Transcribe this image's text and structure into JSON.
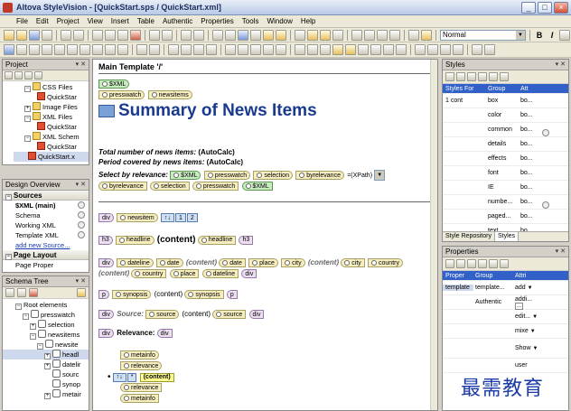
{
  "window": {
    "title": "Altova StyleVision - [QuickStart.sps / QuickStart.xml]"
  },
  "menu": [
    "File",
    "Edit",
    "Project",
    "View",
    "Insert",
    "Table",
    "Authentic",
    "Properties",
    "Tools",
    "Window",
    "Help"
  ],
  "toolbar": {
    "style_combo": "Normal",
    "bold": "B",
    "italic": "I"
  },
  "project": {
    "title": "Project",
    "items": [
      {
        "label": "CSS Files",
        "kind": "folder"
      },
      {
        "label": "QuickStar",
        "kind": "file"
      },
      {
        "label": "Image Files",
        "kind": "folder"
      },
      {
        "label": "XML Files",
        "kind": "folder"
      },
      {
        "label": "QuickStar",
        "kind": "file"
      },
      {
        "label": "XML Schem",
        "kind": "folder"
      },
      {
        "label": "QuickStar",
        "kind": "file"
      },
      {
        "label": "QuickStart.x",
        "kind": "file"
      }
    ]
  },
  "design_overview": {
    "title": "Design Overview",
    "sources_label": "Sources",
    "rows": [
      "$XML (main)",
      "Schema",
      "Working XML",
      "Template XML"
    ],
    "add_link": "add new Source...",
    "page_layout_label": "Page Layout",
    "page_properties": "Page Proper"
  },
  "schema_tree": {
    "title": "Schema Tree",
    "items": [
      "Root elements",
      "presswatch",
      "selection",
      "newsitems",
      "newsite",
      "headl",
      "datelir",
      "sourc",
      "synop",
      "metair"
    ]
  },
  "document": {
    "main_template": "Main Template '/'",
    "xml_tag": "$XML",
    "presswatch_tag": "presswatch",
    "newsitems_tag": "newsitems",
    "heading": "Summary of News Items",
    "total_line": "Total number of news items: ",
    "total_value": "(AutoCalc)",
    "period_line": "Period covered by news items: ",
    "period_value": "(AutoCalc)",
    "select_label": "Select by relevance:",
    "select_tags": [
      "$XML",
      "presswatch",
      "selection",
      "byrelevance"
    ],
    "xpath": "=(XPath)",
    "select_tags2": [
      "byrelevance",
      "selection",
      "presswatch",
      "$XML"
    ],
    "div": "div",
    "newsitem": "newsitem",
    "n1": "1",
    "n2": "2",
    "h3": "h3",
    "headline": "headline",
    "content": "(content)",
    "dateline": "dateline",
    "date": "date",
    "place": "place",
    "city": "city",
    "country": "country",
    "p": "p",
    "synopsis": "synopsis",
    "source_label": "Source: ",
    "source": "source",
    "relevance_label": "Relevance: ",
    "metainfo": "metainfo",
    "relevance": "relevance"
  },
  "styles": {
    "title": "Styles",
    "headers": [
      "Styles For",
      "Group",
      "Att"
    ],
    "first_row": [
      "1",
      "cont",
      "box",
      "bo..."
    ],
    "groups": [
      "color",
      "common",
      "details",
      "effects",
      "font",
      "IE",
      "numbe...",
      "paged...",
      "text"
    ],
    "values": [
      "bo...",
      "bo...",
      "bo...",
      "bo...",
      "bo...",
      "bo...",
      "bo...",
      "bo...",
      "bo..."
    ],
    "tabs": [
      "Style Repository",
      "Styles"
    ]
  },
  "properties": {
    "title": "Properties",
    "headers": [
      "Proper",
      "Group",
      "Attri"
    ],
    "rows": [
      {
        "a": "template",
        "b": "template...",
        "c": "add"
      },
      {
        "a": "",
        "b": "Authentic",
        "c": "addi..."
      },
      {
        "a": "",
        "b": "",
        "c": "edit..."
      },
      {
        "a": "",
        "b": "",
        "c": "mixe"
      },
      {
        "a": "",
        "b": "",
        "c": "Show"
      },
      {
        "a": "",
        "b": "",
        "c": "user"
      }
    ]
  },
  "watermark": "最需教育"
}
